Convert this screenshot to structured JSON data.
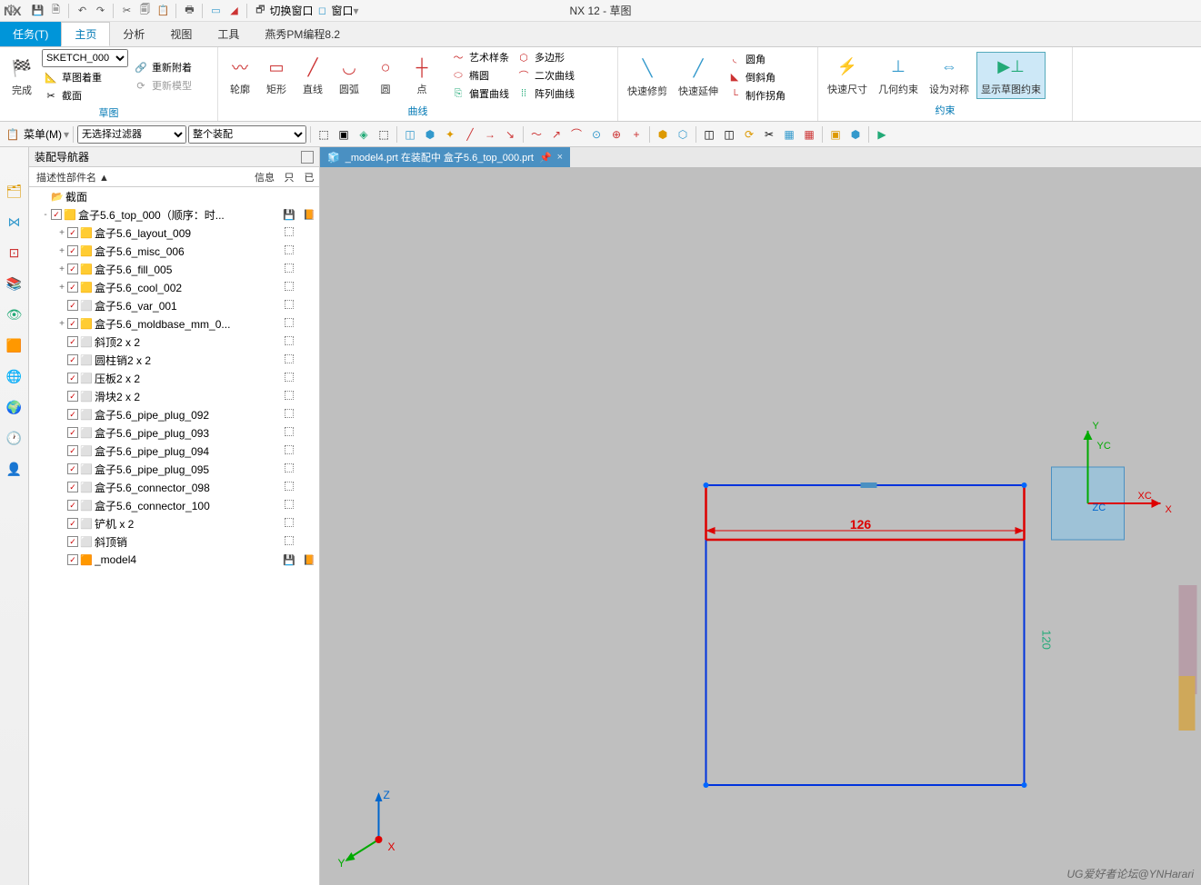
{
  "app": {
    "name": "NX",
    "title": "NX 12 - 草图",
    "switchWindow": "切换窗口",
    "windowMenu": "窗口"
  },
  "menu": {
    "task": "任务(T)",
    "home": "主页",
    "analysis": "分析",
    "view": "视图",
    "tools": "工具",
    "pm": "燕秀PM编程8.2"
  },
  "ribbon": {
    "sketchName": "SKETCH_000",
    "finish": "完成",
    "reattach": "重新附着",
    "orient": "草图着重",
    "section": "截面",
    "updateModel": "更新模型",
    "groupSketch": "草图",
    "profile": "轮廓",
    "rect": "矩形",
    "line": "直线",
    "arc": "圆弧",
    "circle": "圆",
    "point": "点",
    "arts": "艺术样条",
    "ellipse": "椭圆",
    "offset": "偏置曲线",
    "polygon": "多边形",
    "conic": "二次曲线",
    "pattern": "阵列曲线",
    "groupCurve": "曲线",
    "trim": "快速修剪",
    "extend": "快速延伸",
    "fillet": "圆角",
    "chamfer": "倒斜角",
    "corner": "制作拐角",
    "rapidDim": "快速尺寸",
    "geomCons": "几何约束",
    "symmetric": "设为对称",
    "showCons": "显示草图约束",
    "groupCons": "约束"
  },
  "filter": {
    "menuBtn": "菜单(M)",
    "noFilter": "无选择过滤器",
    "scope": "整个装配"
  },
  "nav": {
    "title": "装配导航器",
    "col1": "描述性部件名",
    "col2": "信息",
    "col3": "只",
    "col4": "已",
    "section": "截面"
  },
  "tree": [
    {
      "lvl": 0,
      "exp": "",
      "chk": false,
      "icon": "📂",
      "name": "截面",
      "c3": "",
      "c4": ""
    },
    {
      "lvl": 0,
      "exp": "-",
      "chk": true,
      "icon": "🟨",
      "name": "盒子5.6_top_000（顺序：时...",
      "c3": "💾",
      "c4": "📙"
    },
    {
      "lvl": 1,
      "exp": "+",
      "chk": true,
      "icon": "🟨",
      "name": "盒子5.6_layout_009",
      "c3": "⬚",
      "c4": ""
    },
    {
      "lvl": 1,
      "exp": "+",
      "chk": true,
      "icon": "🟨",
      "name": "盒子5.6_misc_006",
      "c3": "⬚",
      "c4": ""
    },
    {
      "lvl": 1,
      "exp": "+",
      "chk": true,
      "icon": "🟨",
      "name": "盒子5.6_fill_005",
      "c3": "⬚",
      "c4": ""
    },
    {
      "lvl": 1,
      "exp": "+",
      "chk": true,
      "icon": "🟨",
      "name": "盒子5.6_cool_002",
      "c3": "⬚",
      "c4": ""
    },
    {
      "lvl": 1,
      "exp": "",
      "chk": true,
      "icon": "⬜",
      "name": "盒子5.6_var_001",
      "c3": "⬚",
      "c4": ""
    },
    {
      "lvl": 1,
      "exp": "+",
      "chk": true,
      "icon": "🟨",
      "name": "盒子5.6_moldbase_mm_0...",
      "c3": "⬚",
      "c4": ""
    },
    {
      "lvl": 1,
      "exp": "",
      "chk": true,
      "icon": "⬜",
      "name": "斜顶2 x 2",
      "c3": "⬚",
      "c4": ""
    },
    {
      "lvl": 1,
      "exp": "",
      "chk": true,
      "icon": "⬜",
      "name": "圆柱销2 x 2",
      "c3": "⬚",
      "c4": ""
    },
    {
      "lvl": 1,
      "exp": "",
      "chk": true,
      "icon": "⬜",
      "name": "压板2 x 2",
      "c3": "⬚",
      "c4": ""
    },
    {
      "lvl": 1,
      "exp": "",
      "chk": true,
      "icon": "⬜",
      "name": "滑块2 x 2",
      "c3": "⬚",
      "c4": ""
    },
    {
      "lvl": 1,
      "exp": "",
      "chk": true,
      "icon": "⬜",
      "name": "盒子5.6_pipe_plug_092",
      "c3": "⬚",
      "c4": ""
    },
    {
      "lvl": 1,
      "exp": "",
      "chk": true,
      "icon": "⬜",
      "name": "盒子5.6_pipe_plug_093",
      "c3": "⬚",
      "c4": ""
    },
    {
      "lvl": 1,
      "exp": "",
      "chk": true,
      "icon": "⬜",
      "name": "盒子5.6_pipe_plug_094",
      "c3": "⬚",
      "c4": ""
    },
    {
      "lvl": 1,
      "exp": "",
      "chk": true,
      "icon": "⬜",
      "name": "盒子5.6_pipe_plug_095",
      "c3": "⬚",
      "c4": ""
    },
    {
      "lvl": 1,
      "exp": "",
      "chk": true,
      "icon": "⬜",
      "name": "盒子5.6_connector_098",
      "c3": "⬚",
      "c4": ""
    },
    {
      "lvl": 1,
      "exp": "",
      "chk": true,
      "icon": "⬜",
      "name": "盒子5.6_connector_100",
      "c3": "⬚",
      "c4": ""
    },
    {
      "lvl": 1,
      "exp": "",
      "chk": true,
      "icon": "⬜",
      "name": "铲机 x 2",
      "c3": "⬚",
      "c4": ""
    },
    {
      "lvl": 1,
      "exp": "",
      "chk": true,
      "icon": "⬜",
      "name": "斜顶销",
      "c3": "⬚",
      "c4": ""
    },
    {
      "lvl": 1,
      "exp": "",
      "chk": true,
      "icon": "🟧",
      "name": "_model4",
      "c3": "💾",
      "c4": "📙"
    }
  ],
  "fileTab": "_model4.prt 在装配中 盒子5.6_top_000.prt",
  "sketch": {
    "dim": "126",
    "vdim": "120",
    "axis": {
      "x": "X",
      "y": "Y",
      "z": "Z",
      "xc": "XC",
      "yc": "YC",
      "zc": "ZC"
    }
  },
  "watermark": "UG爱好者论坛@YNHarari"
}
